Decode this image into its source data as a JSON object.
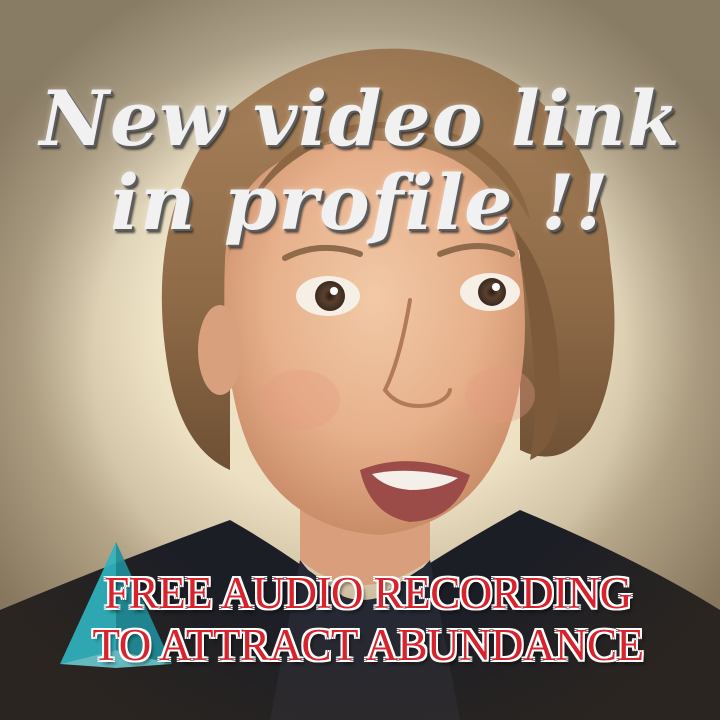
{
  "headline": {
    "line1": "New video link",
    "line2": "in profile !!"
  },
  "promo": {
    "line1": "FREE AUDIO RECORDING",
    "line2": "TO ATTRACT ABUNDANCE"
  },
  "colors": {
    "headline_text": "#f1f1f1",
    "promo_text": "#d8222c",
    "pyramid": "#2fb3bf",
    "background": "#efe6cf"
  },
  "icons": {
    "pyramid": "pyramid-icon"
  }
}
